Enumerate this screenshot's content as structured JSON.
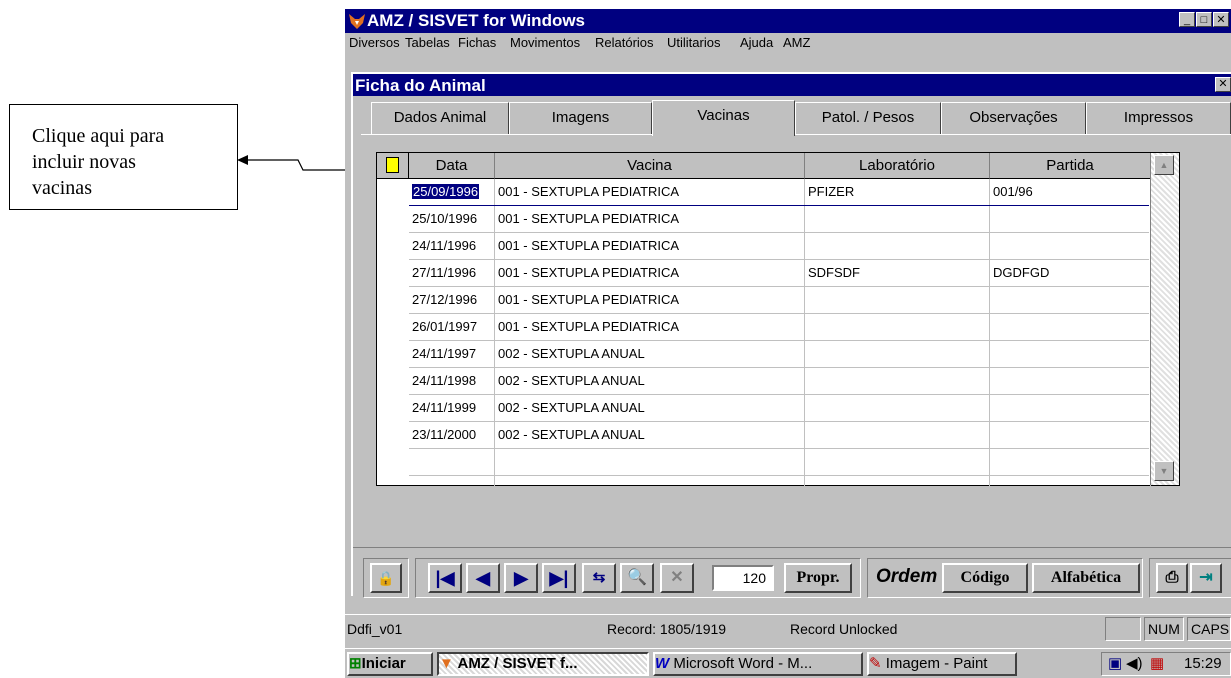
{
  "callout": {
    "text_lines": [
      "Clique aqui para",
      "incluir novas",
      "vacinas"
    ]
  },
  "app": {
    "title": "AMZ / SISVET for Windows",
    "menu": [
      "Diversos",
      "Tabelas",
      "Fichas",
      "Movimentos",
      "Relatórios",
      "Utilitarios",
      "Ajuda",
      "AMZ"
    ]
  },
  "child": {
    "title": "Ficha do Animal",
    "tabs": [
      "Dados Animal",
      "Imagens",
      "Vacinas",
      "Patol. / Pesos",
      "Observações",
      "Impressos"
    ],
    "active_tab": "Vacinas"
  },
  "grid": {
    "columns": [
      "Data",
      "Vacina",
      "Laboratório",
      "Partida"
    ],
    "rows": [
      {
        "data": "25/09/1996",
        "vacina": "001 - SEXTUPLA PEDIATRICA",
        "laboratorio": "PFIZER",
        "partida": "001/96"
      },
      {
        "data": "25/10/1996",
        "vacina": "001 - SEXTUPLA PEDIATRICA",
        "laboratorio": "",
        "partida": ""
      },
      {
        "data": "24/11/1996",
        "vacina": "001 - SEXTUPLA PEDIATRICA",
        "laboratorio": "",
        "partida": ""
      },
      {
        "data": "27/11/1996",
        "vacina": "001 - SEXTUPLA PEDIATRICA",
        "laboratorio": "SDFSDF",
        "partida": "DGDFGD"
      },
      {
        "data": "27/12/1996",
        "vacina": "001 - SEXTUPLA PEDIATRICA",
        "laboratorio": "",
        "partida": ""
      },
      {
        "data": "26/01/1997",
        "vacina": "001 - SEXTUPLA PEDIATRICA",
        "laboratorio": "",
        "partida": ""
      },
      {
        "data": "24/11/1997",
        "vacina": "002 - SEXTUPLA ANUAL",
        "laboratorio": "",
        "partida": ""
      },
      {
        "data": "24/11/1998",
        "vacina": "002 - SEXTUPLA ANUAL",
        "laboratorio": "",
        "partida": ""
      },
      {
        "data": "24/11/1999",
        "vacina": "002 - SEXTUPLA ANUAL",
        "laboratorio": "",
        "partida": ""
      },
      {
        "data": "23/11/2000",
        "vacina": "002 - SEXTUPLA ANUAL",
        "laboratorio": "",
        "partida": ""
      },
      {
        "data": "",
        "vacina": "",
        "laboratorio": "",
        "partida": ""
      },
      {
        "data": "",
        "vacina": "",
        "laboratorio": "",
        "partida": ""
      }
    ]
  },
  "toolbar": {
    "record_number": "120",
    "propr_label": "Propr.",
    "ordem_label": "Ordem",
    "codigo_label": "Código",
    "alfabetica_label": "Alfabética"
  },
  "status": {
    "form": "Ddfi_v01",
    "record": "Record: 1805/1919",
    "lock": "Record Unlocked",
    "num": "NUM",
    "caps": "CAPS"
  },
  "taskbar": {
    "start": "Iniciar",
    "tasks": [
      "AMZ / SISVET f...",
      "Microsoft Word - M...",
      "Imagem - Paint"
    ],
    "time": "15:29"
  },
  "colors": {
    "titlebar": "#000080",
    "face": "#c0c0c0",
    "selection": "#000080",
    "new_icon": "#ffff00"
  }
}
